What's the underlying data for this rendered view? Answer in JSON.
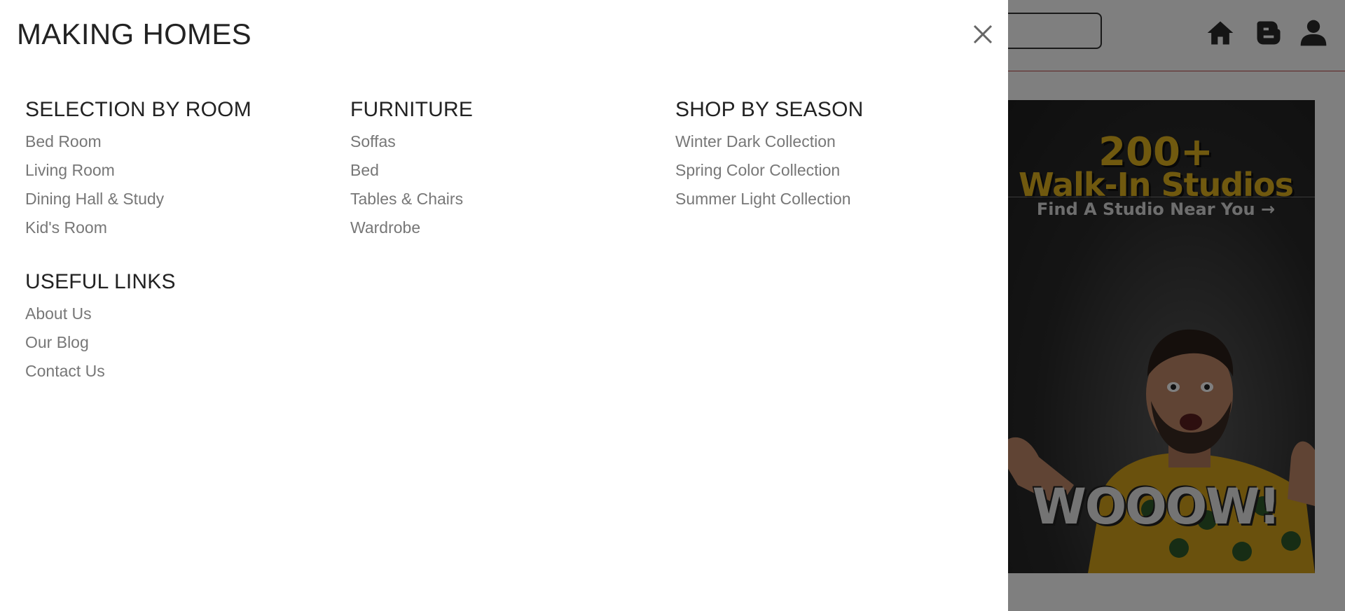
{
  "drawer": {
    "title": "MAKING HOMES",
    "close_icon": "close-icon",
    "sections": [
      {
        "heading": "SELECTION BY ROOM",
        "links": [
          "Bed Room",
          "Living Room",
          "Dining Hall & Study",
          "Kid's Room"
        ]
      },
      {
        "heading": "FURNITURE",
        "links": [
          "Soffas",
          "Bed",
          "Tables & Chairs",
          "Wardrobe"
        ]
      },
      {
        "heading": "SHOP BY SEASON",
        "links": [
          "Winter Dark Collection",
          "Spring Color Collection",
          "Summer Light Collection"
        ]
      },
      {
        "heading": "USEFUL LINKS",
        "links": [
          "About Us",
          "Our Blog",
          "Contact Us"
        ]
      }
    ]
  },
  "header": {
    "icons": [
      "home-icon",
      "blogger-icon",
      "user-icon"
    ]
  },
  "promo": {
    "number": "200+",
    "headline": "Walk-In Studios",
    "subline": "Find A Studio Near You →",
    "caption": "WOOOW!"
  },
  "colors": {
    "accent_gold": "#e0b21f",
    "link_gray": "#777777",
    "heading_dark": "#222222",
    "header_border": "#bb4444"
  }
}
